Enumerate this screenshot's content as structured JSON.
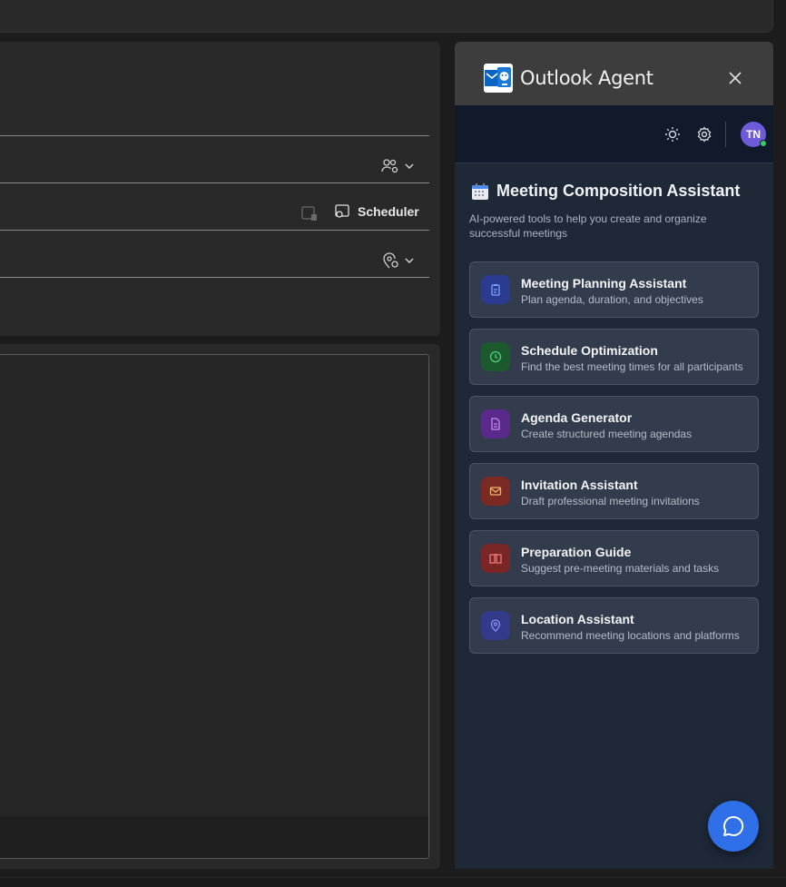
{
  "compose": {
    "scheduler_label": "Scheduler"
  },
  "agent": {
    "title": "Outlook Agent",
    "user_initials": "TN",
    "section_title": "Meeting Composition Assistant",
    "section_description": "AI-powered tools to help you create and organize successful meetings",
    "tools": [
      {
        "name": "Meeting Planning Assistant",
        "description": "Plan agenda, duration, and objectives",
        "icon": "clipboard-icon",
        "bg": "#2b3b8f",
        "fg": "#7aa2ff"
      },
      {
        "name": "Schedule Optimization",
        "description": "Find the best meeting times for all participants",
        "icon": "clock-icon",
        "bg": "#1c5a2e",
        "fg": "#4cd07a"
      },
      {
        "name": "Agenda Generator",
        "description": "Create structured meeting agendas",
        "icon": "document-icon",
        "bg": "#5a2a8a",
        "fg": "#c58af2"
      },
      {
        "name": "Invitation Assistant",
        "description": "Draft professional meeting invitations",
        "icon": "envelope-icon",
        "bg": "#7a2a22",
        "fg": "#f0b36a"
      },
      {
        "name": "Preparation Guide",
        "description": "Suggest pre-meeting materials and tasks",
        "icon": "book-icon",
        "bg": "#7a2626",
        "fg": "#f07a7a"
      },
      {
        "name": "Location Assistant",
        "description": "Recommend meeting locations and platforms",
        "icon": "location-pin-icon",
        "bg": "#333a8a",
        "fg": "#8a93f5"
      }
    ]
  }
}
